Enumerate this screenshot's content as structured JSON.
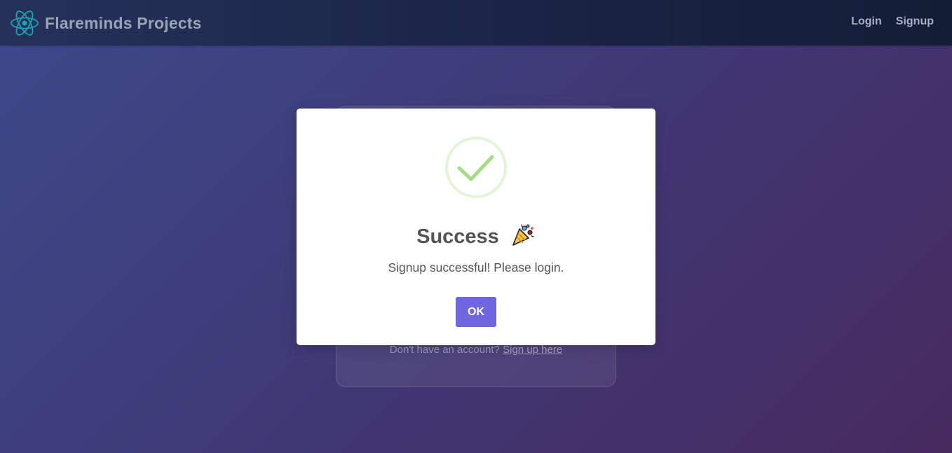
{
  "navbar": {
    "logo_icon": "react-atom-icon",
    "brand_title": "Flareminds Projects",
    "links": {
      "login": "Login",
      "signup": "Signup"
    }
  },
  "background_card": {
    "footer_text": "Don't have an account?",
    "footer_link": "Sign up here"
  },
  "modal": {
    "status_icon": "success-check-icon",
    "title": "Success",
    "title_emoji_icon": "party-popper-icon",
    "message": "Signup successful! Please login.",
    "confirm_label": "OK",
    "colors": {
      "confirm": "#7066e0",
      "success": "#a5dc86"
    }
  }
}
